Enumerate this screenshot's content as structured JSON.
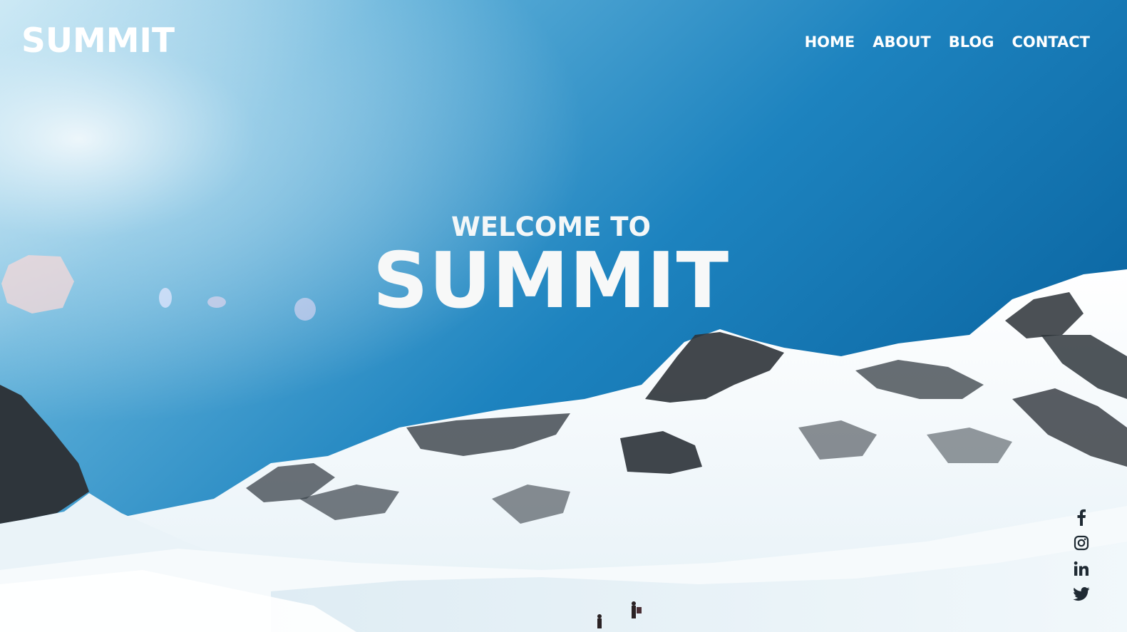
{
  "site": {
    "logo_text": "SUMMIT"
  },
  "nav": {
    "items": [
      {
        "label": "HOME"
      },
      {
        "label": "ABOUT"
      },
      {
        "label": "BLOG"
      },
      {
        "label": "CONTACT"
      }
    ]
  },
  "hero": {
    "kicker": "WELCOME TO",
    "title": "SUMMIT"
  },
  "social": {
    "icons": [
      "facebook-icon",
      "instagram-icon",
      "linkedin-icon",
      "twitter-icon"
    ],
    "icon_color": "#1f2a33"
  },
  "colors": {
    "sky_top": "#0b6aa6",
    "sky_light": "#54a9d6",
    "snow": "#f3f7f9",
    "rock": "#2c3238",
    "text": "#ffffff"
  }
}
